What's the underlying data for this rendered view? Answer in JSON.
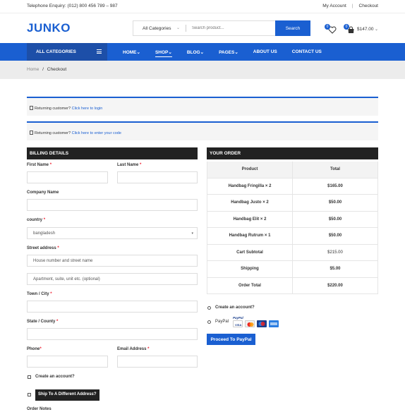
{
  "topbar": {
    "phone": "Telephone Enquiry: (012) 800 456 789 – 987",
    "my_account": "My Account",
    "separator": "|",
    "checkout": "Checkout"
  },
  "header": {
    "logo": "JUNKO",
    "category_select": "All Categories",
    "search_placeholder": "Search product...",
    "search_button": "Search",
    "wishlist_count": "0",
    "cart_count": "0",
    "cart_total": "$147.00"
  },
  "nav": {
    "all_categories": "ALL CATEGORIES",
    "items": [
      "HOME",
      "SHOP",
      "BLOG",
      "PAGES",
      "ABOUT US",
      "CONTACT US"
    ],
    "dropdown_items": [
      true,
      true,
      true,
      true,
      false,
      false
    ],
    "active": "SHOP"
  },
  "breadcrumb": {
    "home": "Home",
    "sep": "/",
    "current": "Checkout"
  },
  "notices": [
    {
      "text": "Returning customer?",
      "link": "Click here to login"
    },
    {
      "text": "Returning customer?",
      "link": "Click here to enter your code"
    }
  ],
  "billing": {
    "heading": "BILLING DETAILS",
    "first_name": "First Name",
    "last_name": "Last Name",
    "company_name": "Company Name",
    "country": "country",
    "country_value": "bangladesh",
    "street_address": "Street address",
    "street_placeholder": "House number and street name",
    "apartment_placeholder": "Apartment, suite, unit etc. (optional)",
    "town": "Town / City",
    "state": "State / County",
    "phone": "Phone",
    "email": "Email Address",
    "create_account": "Create an account?",
    "ship_different": "Ship To A Different Address?",
    "order_notes": "Order Notes",
    "required_mark": "*"
  },
  "order": {
    "heading": "YOUR ORDER",
    "col_product": "Product",
    "col_total": "Total",
    "items": [
      {
        "name": "Handbag Fringilla",
        "qty": "× 2",
        "total": "$165.00"
      },
      {
        "name": "Handbag Justo",
        "qty": "× 2",
        "total": "$50.00"
      },
      {
        "name": "Handbag Elit",
        "qty": "× 2",
        "total": "$50.00"
      },
      {
        "name": "Handbag Rutrum",
        "qty": "× 1",
        "total": "$50.00"
      }
    ],
    "cart_subtotal_label": "Cart Subtotal",
    "cart_subtotal": "$215.00",
    "shipping_label": "Shipping",
    "shipping": "$5.00",
    "order_total_label": "Order Total",
    "order_total": "$220.00",
    "create_account": "Create an account?",
    "paypal_label": "PayPal",
    "paypal_logo_text": "PayPal",
    "proceed_button": "Proceed To PayPal"
  },
  "colors": {
    "brand_blue": "#1a5fd1",
    "nav_dark_blue": "#1d4fa8",
    "section_header": "#222222",
    "required": "#ee2233"
  }
}
